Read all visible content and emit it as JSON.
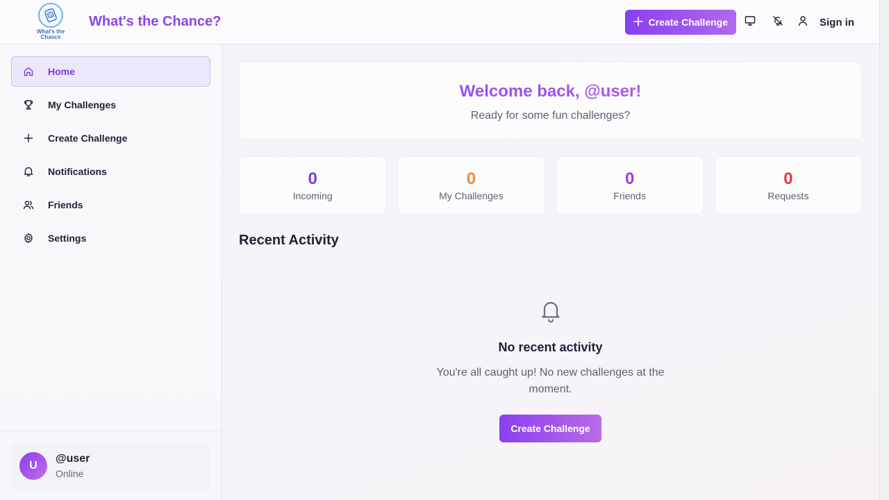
{
  "header": {
    "logo_text_line1": "What's the",
    "logo_text_line2": "Chance",
    "title": "What's the Chance?",
    "create_label": "Create Challenge",
    "signin_label": "Sign in"
  },
  "sidebar": {
    "items": [
      {
        "label": "Home",
        "icon": "home-icon",
        "active": true
      },
      {
        "label": "My Challenges",
        "icon": "trophy-icon"
      },
      {
        "label": "Create Challenge",
        "icon": "plus-icon"
      },
      {
        "label": "Notifications",
        "icon": "bell-icon"
      },
      {
        "label": "Friends",
        "icon": "users-icon"
      },
      {
        "label": "Settings",
        "icon": "gear-icon"
      }
    ],
    "user": {
      "avatar_letter": "U",
      "name": "@user",
      "status": "Online"
    }
  },
  "main": {
    "welcome_title": "Welcome back, @user!",
    "welcome_subtitle": "Ready for some fun challenges?",
    "stats": [
      {
        "value": "0",
        "label": "Incoming",
        "color": "#7a3be2"
      },
      {
        "value": "0",
        "label": "My Challenges",
        "color": "#f08a3c"
      },
      {
        "value": "0",
        "label": "Friends",
        "color": "#9b3fd6"
      },
      {
        "value": "0",
        "label": "Requests",
        "color": "#e5393d"
      }
    ],
    "recent_title": "Recent Activity",
    "empty_title": "No recent activity",
    "empty_desc": "You're all caught up! No new challenges at the moment.",
    "empty_button": "Create Challenge"
  },
  "colors": {
    "accent": "#8a3ff0",
    "accent_light": "#b96ae6"
  }
}
